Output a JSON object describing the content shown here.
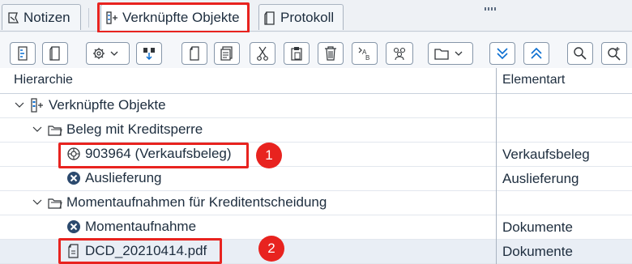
{
  "tabs": [
    {
      "label": "Notizen",
      "icon": "note-icon"
    },
    {
      "label": "Verknüpfte Objekte",
      "icon": "linked-objects-icon",
      "active": true
    },
    {
      "label": "Protokoll",
      "icon": "log-icon"
    }
  ],
  "toolbar": {
    "buttons": [
      "tree-icon",
      "document-icon",
      "settings-dropdown-icon",
      "connect-icon",
      "page-icon",
      "copy-doc-icon",
      "cut-icon",
      "paste-icon",
      "delete-icon",
      "sort-icon",
      "users-icon",
      "folder-dropdown-icon",
      "collapse-all-icon",
      "expand-all-icon",
      "search-icon",
      "search-next-icon"
    ]
  },
  "grid": {
    "columns": [
      "Hierarchie",
      "Elementart"
    ],
    "rows": [
      {
        "label": "Verknüpfte Objekte",
        "type": "",
        "level": 0,
        "expanded": true,
        "icon": "linked-objects-icon"
      },
      {
        "label": "Beleg mit Kreditsperre",
        "type": "",
        "level": 1,
        "expanded": true,
        "icon": "folder-open-icon"
      },
      {
        "label": "903964 (Verkaufsbeleg)",
        "type": "Verkaufsbeleg",
        "level": 2,
        "icon": "sales-doc-icon"
      },
      {
        "label": "Auslieferung",
        "type": "Auslieferung",
        "level": 2,
        "icon": "blocked-icon"
      },
      {
        "label": "Momentaufnahmen für Kreditentscheidung",
        "type": "",
        "level": 1,
        "expanded": true,
        "icon": "folder-open-icon"
      },
      {
        "label": "Momentaufnahme",
        "type": "Dokumente",
        "level": 2,
        "icon": "blocked-icon"
      },
      {
        "label": "DCD_20210414.pdf",
        "type": "Dokumente",
        "level": 2,
        "icon": "pdf-file-icon",
        "selected": true
      }
    ]
  },
  "annotations": [
    "1",
    "2"
  ],
  "colors": {
    "accent": "#0a6ed1",
    "highlight": "#e8231f",
    "text": "#1d2d3e",
    "blocked": "#2c4a6e"
  }
}
